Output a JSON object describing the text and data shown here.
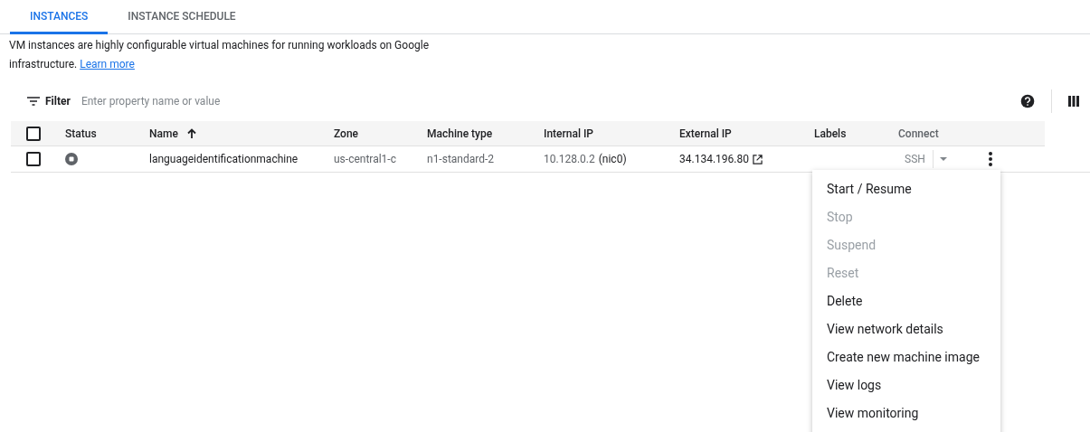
{
  "tabs": [
    {
      "label": "INSTANCES",
      "selected": true
    },
    {
      "label": "INSTANCE SCHEDULE",
      "selected": false
    }
  ],
  "description": {
    "text": "VM instances are highly configurable virtual machines for running workloads on Google infrastructure.",
    "link": "Learn more"
  },
  "filter": {
    "label": "Filter",
    "placeholder": "Enter property name or value"
  },
  "table": {
    "select_all": {
      "checked": false
    },
    "columns": [
      "Status",
      "Name",
      "Zone",
      "Machine type",
      "Internal IP",
      "External IP",
      "Labels",
      "Connect"
    ],
    "rows": [
      {
        "checked": false,
        "stopped": true,
        "name": "languageidentificationmachine",
        "zone": "us-central1-c",
        "machine_type": "n1-standard-2",
        "internal_ip": "10.128.0.2",
        "nic": "(nic0)",
        "external_ip": "34.134.196.80",
        "connect": {
          "label": "SSH",
          "disabled": true
        }
      }
    ]
  },
  "menu": [
    {
      "label": "Start / Resume",
      "disabled": false
    },
    {
      "label": "Stop",
      "disabled": true
    },
    {
      "label": "Suspend",
      "disabled": true
    },
    {
      "label": "Reset",
      "disabled": true
    },
    {
      "label": "Delete",
      "disabled": false
    },
    {
      "label": "View network details",
      "disabled": false
    },
    {
      "label": "Create new machine image",
      "disabled": false
    },
    {
      "label": "View logs",
      "disabled": false
    },
    {
      "label": "View monitoring",
      "disabled": false
    }
  ]
}
